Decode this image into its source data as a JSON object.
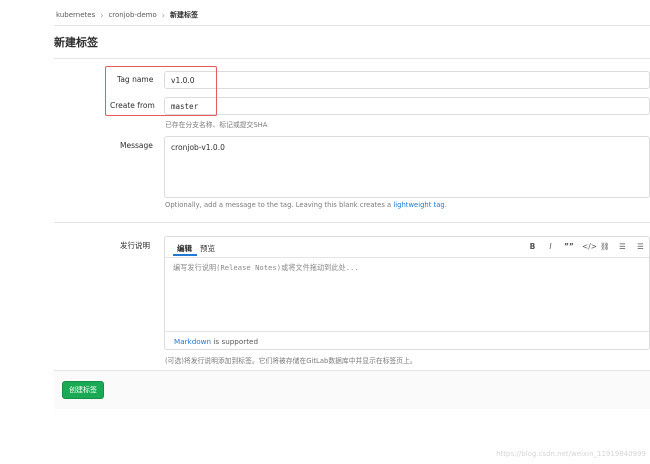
{
  "breadcrumb": {
    "items": [
      "kubernetes",
      "cronjob-demo",
      "新建标签"
    ],
    "separator": "›"
  },
  "page": {
    "title": "新建标签"
  },
  "form": {
    "tag_name": {
      "label": "Tag name",
      "value": "v1.0.0"
    },
    "create_from": {
      "label": "Create from",
      "value": "master",
      "hint": "已存在分支名称、标记或提交SHA"
    },
    "message": {
      "label": "Message",
      "value": "cronjob-v1.0.0",
      "hint_prefix": "Optionally, add a message to the tag. Leaving this blank creates a",
      "hint_link": "lightweight tag",
      "hint_suffix": "."
    },
    "release_notes": {
      "label": "发行说明",
      "tabs": {
        "write": "编辑",
        "preview": "预览"
      },
      "toolbar": {
        "bold": "B",
        "italic": "I",
        "quote": "””",
        "code": "</>",
        "link": "⛓",
        "bullet_list": "☰",
        "numbered_list": "☰"
      },
      "placeholder": "编写发行说明(Release Notes)或将文件拖动到此处...",
      "markdown_link": "Markdown",
      "markdown_suffix": "is supported",
      "hint": "(可选)将发行说明添加到标签。它们将被存储在GitLab数据库中并显示在标签页上。"
    }
  },
  "actions": {
    "create_label": "创建标签"
  },
  "watermark": "https://blog.csdn.net/weixin_11919840999"
}
